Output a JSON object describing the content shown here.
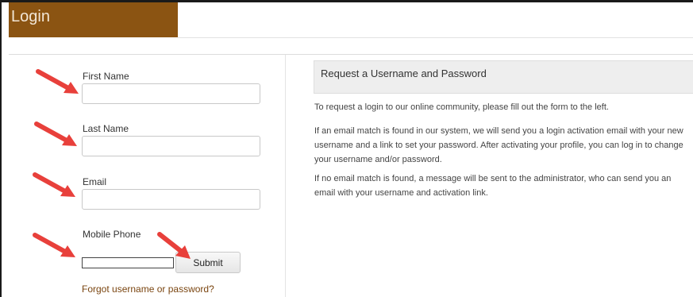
{
  "header": {
    "title": "Login"
  },
  "form": {
    "first_name_label": "First Name",
    "first_name_value": "",
    "last_name_label": "Last Name",
    "last_name_value": "",
    "email_label": "Email",
    "email_value": "",
    "mobile_phone_label": "Mobile Phone",
    "mobile_phone_value": "",
    "submit_label": "Submit",
    "forgot_link": "Forgot username or password?"
  },
  "info": {
    "title": "Request a Username and Password",
    "paragraph1": "To request a login to our online community, please fill out the form to the left.",
    "paragraph2_lines": [
      "If an email match is found in our system, we will send you a login activation email with your new",
      "username and a link to set your password. After activating your profile, you can log in to change",
      "your username and/or password."
    ],
    "paragraph3_lines": [
      "If no email match is found, a message will be sent to the administrator, who can send you an",
      "email with your username and activation link."
    ]
  },
  "annotations": {
    "arrow_color": "#e8403b",
    "arrow_count": 5
  },
  "colors": {
    "brand": "#8b5412",
    "link": "#7a4510",
    "header_panel": "#eeeeee"
  }
}
